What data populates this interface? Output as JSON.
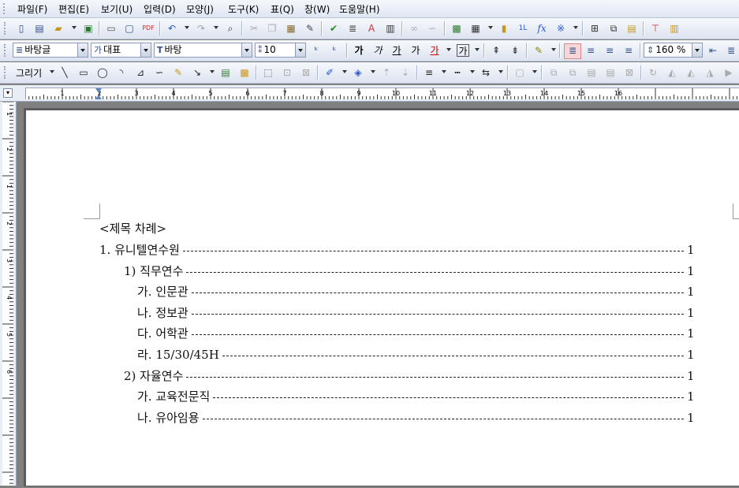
{
  "menu": [
    "파일(F)",
    "편집(E)",
    "보기(U)",
    "입력(D)",
    "모양(J)",
    "도구(K)",
    "표(Q)",
    "창(W)",
    "도움말(H)"
  ],
  "format_bar": {
    "style": "바탕글",
    "lang": "대표",
    "font": "바탕",
    "size": "10",
    "zoom": "160 %"
  },
  "draw_bar": {
    "label": "그리기"
  },
  "document": {
    "heading": "<제목 차례>",
    "toc": [
      {
        "text": "1. 유니텔연수원",
        "page": "1"
      },
      {
        "text": "1) 직무연수",
        "page": "1"
      },
      {
        "text": "가. 인문관",
        "page": "1"
      },
      {
        "text": "나. 정보관",
        "page": "1"
      },
      {
        "text": "다. 어학관",
        "page": "1"
      },
      {
        "text": "라. 15/30/45H",
        "page": "1"
      },
      {
        "text": "2) 자율연수",
        "page": "1"
      },
      {
        "text": "가. 교육전문직",
        "page": "1"
      },
      {
        "text": "나. 유아임용",
        "page": "1"
      }
    ]
  },
  "ruler": {
    "h_numbers": [
      "1",
      "2",
      "3",
      "4",
      "5",
      "6",
      "7",
      "8",
      "9",
      "10",
      "11",
      "12",
      "13",
      "14",
      "15",
      "16"
    ],
    "v_numbers": [
      "1",
      "2",
      "1",
      "2",
      "3",
      "4",
      "5",
      "6"
    ]
  },
  "icons": {
    "standard": [
      "new-doc-icon",
      "template-icon",
      "open-icon",
      "save-icon",
      "print-icon",
      "preview-icon",
      "pdf-icon",
      "undo-icon",
      "redo-icon",
      "find-icon",
      "cut-icon",
      "copy-icon",
      "paste-icon",
      "format-painter-icon",
      "spell-check-icon",
      "paragraph-icon",
      "char-map-icon",
      "columns-icon",
      "link-icon",
      "unlink-icon",
      "image-icon",
      "table-icon",
      "chart-icon",
      "field-icon",
      "formula-icon",
      "symbol-icon",
      "header-icon",
      "page-icon",
      "bookmark-icon",
      "presentation-icon",
      "book-icon"
    ],
    "format": [
      "grow-font-icon",
      "shrink-font-icon",
      "bold-icon",
      "italic-icon",
      "underline-icon",
      "strike-icon",
      "font-color-icon",
      "char-shade-icon",
      "superscript-icon",
      "subscript-icon",
      "highlight-icon",
      "align-justify-icon",
      "align-left-icon",
      "align-center-icon",
      "align-right-icon",
      "indent-icon"
    ],
    "draw": [
      "line-icon",
      "rect-icon",
      "ellipse-icon",
      "arc-icon",
      "polygon-icon",
      "curve-icon",
      "pencil-icon",
      "connector-icon",
      "textbox-icon",
      "picture-icon",
      "select-icon",
      "group-icon",
      "ungroup-icon",
      "line-color-icon",
      "fill-color-icon",
      "bring-front-icon",
      "send-back-icon",
      "line-style-icon",
      "dash-icon",
      "arrow-style-icon",
      "shadow-icon",
      "align-objects-icon",
      "rotate-icon",
      "flip-icon"
    ]
  }
}
